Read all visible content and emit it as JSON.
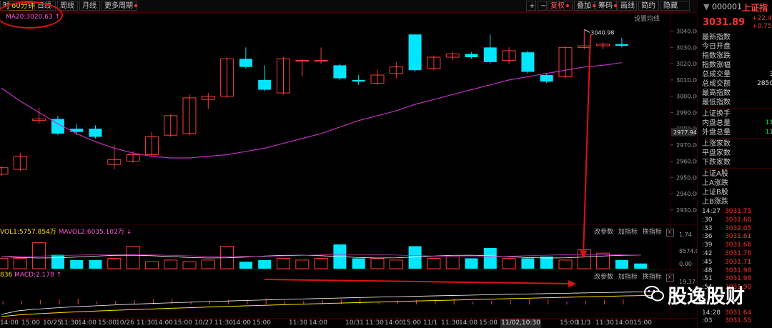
{
  "toolbar": {
    "left_tabs": [
      {
        "label": "时",
        "active": false
      },
      {
        "label": "60分钟",
        "active": true
      },
      {
        "label": "日线",
        "active": false
      },
      {
        "label": "周线",
        "active": false
      },
      {
        "label": "月线",
        "active": false
      },
      {
        "label": "更多周期",
        "active": false,
        "dot": true
      }
    ],
    "right_buttons": [
      {
        "label": "+"
      },
      {
        "label": "−"
      },
      {
        "label": "复权",
        "highlight": true,
        "dot": true
      },
      {
        "label": "叠加",
        "dot": true
      },
      {
        "label": "筹码",
        "dot": true
      },
      {
        "label": "画线"
      },
      {
        "label": "简约"
      },
      {
        "label": "隐藏"
      }
    ]
  },
  "indicator_labels": {
    "ma": "MA20:3020.63",
    "setting": "设置均线",
    "vol_prefix": "VOL1:5757.854万",
    "vol_ma": "MAVOL2:6035.102万",
    "macd_prefix": "836",
    "macd_label": "MACD:2.178"
  },
  "panel_controls": [
    "改参数",
    "加指标",
    "换指标"
  ],
  "panel_controls2": [
    "改参数",
    "加指标",
    "换指标"
  ],
  "price_tag": "2977.94",
  "chart_data": [
    {
      "type": "candlestick",
      "title": "",
      "ylim": [
        2922,
        3046
      ],
      "yticks": [
        3040,
        3030,
        3020,
        3010,
        3000,
        2990,
        2980,
        2970,
        2960,
        2950,
        2940,
        2930
      ],
      "ytick_labels": [
        "3040.00",
        "3030.00",
        "3020.00",
        "3010.00",
        "3000.00",
        "2990.00",
        "2980.00",
        "2970.00",
        "2960.00",
        "2950.00",
        "2940.00",
        "2930.00"
      ],
      "annotation": {
        "text": "3040.98",
        "value": 3040.98,
        "index": 31
      },
      "candles": [
        {
          "o": 2952,
          "c": 2956,
          "h": 2957,
          "l": 2951
        },
        {
          "o": 2955,
          "c": 2963,
          "h": 2965,
          "l": 2954
        },
        {
          "o": 2985,
          "c": 2986,
          "h": 2993,
          "l": 2983
        },
        {
          "o": 2986,
          "c": 2977,
          "h": 2988,
          "l": 2976
        },
        {
          "o": 2980,
          "c": 2978,
          "h": 2983,
          "l": 2976
        },
        {
          "o": 2980,
          "c": 2975,
          "h": 2982,
          "l": 2974
        },
        {
          "o": 2958,
          "c": 2961,
          "h": 2970,
          "l": 2955
        },
        {
          "o": 2960,
          "c": 2964,
          "h": 2966,
          "l": 2959
        },
        {
          "o": 2964,
          "c": 2975,
          "h": 2978,
          "l": 2963
        },
        {
          "o": 2976,
          "c": 2988,
          "h": 2989,
          "l": 2975
        },
        {
          "o": 2977,
          "c": 2999,
          "h": 3001,
          "l": 2976
        },
        {
          "o": 2998,
          "c": 3000,
          "h": 3002,
          "l": 2992
        },
        {
          "o": 3000,
          "c": 3023,
          "h": 3024,
          "l": 2999
        },
        {
          "o": 3023,
          "c": 3018,
          "h": 3030,
          "l": 3017
        },
        {
          "o": 3010,
          "c": 3004,
          "h": 3019,
          "l": 3003
        },
        {
          "o": 3002,
          "c": 3023,
          "h": 3024,
          "l": 3001
        },
        {
          "o": 3022,
          "c": 3022,
          "h": 3023,
          "l": 3012
        },
        {
          "o": 3022,
          "c": 3022,
          "h": 3030,
          "l": 3020
        },
        {
          "o": 3019,
          "c": 3011,
          "h": 3020,
          "l": 3010
        },
        {
          "o": 3010,
          "c": 3009,
          "h": 3013,
          "l": 3007
        },
        {
          "o": 3008,
          "c": 3013,
          "h": 3016,
          "l": 3007
        },
        {
          "o": 3014,
          "c": 3018,
          "h": 3021,
          "l": 3011
        },
        {
          "o": 3038,
          "c": 3016,
          "h": 3038,
          "l": 3015
        },
        {
          "o": 3017,
          "c": 3024,
          "h": 3025,
          "l": 3016
        },
        {
          "o": 3024,
          "c": 3026,
          "h": 3027,
          "l": 3022
        },
        {
          "o": 3026,
          "c": 3024,
          "h": 3027,
          "l": 3023
        },
        {
          "o": 3030,
          "c": 3021,
          "h": 3038,
          "l": 3020
        },
        {
          "o": 3022,
          "c": 3028,
          "h": 3030,
          "l": 3020
        },
        {
          "o": 3027,
          "c": 3015,
          "h": 3028,
          "l": 3014
        },
        {
          "o": 3013,
          "c": 3009,
          "h": 3014,
          "l": 3008
        },
        {
          "o": 3012,
          "c": 3030,
          "h": 3031,
          "l": 3011
        },
        {
          "o": 3030,
          "c": 3031,
          "h": 3041,
          "l": 3029
        },
        {
          "o": 3031,
          "c": 3032,
          "h": 3033,
          "l": 3029
        },
        {
          "o": 3032,
          "c": 3031,
          "h": 3036,
          "l": 3030
        }
      ],
      "ma20": [
        3005,
        2997,
        2990,
        2983,
        2977,
        2972,
        2968,
        2965,
        2963,
        2962,
        2962,
        2963,
        2964,
        2966,
        2968,
        2971,
        2974,
        2977,
        2981,
        2985,
        2988,
        2991,
        2995,
        2998,
        3001,
        3004,
        3007,
        3010,
        3012,
        3014,
        3016,
        3018,
        3019,
        3020.63
      ]
    },
    {
      "type": "bar",
      "title": "Volume",
      "ylim": [
        0,
        19
      ],
      "yticks": [
        1.74,
        8574.0,
        0.0
      ],
      "ytick_labels": [
        "1.74",
        "8574.00",
        "0.00"
      ],
      "values": [
        6,
        6,
        15,
        8,
        5,
        5,
        6,
        13,
        4,
        5,
        4,
        5,
        13,
        4,
        5,
        6,
        5,
        6,
        14,
        6,
        6,
        5,
        13,
        6,
        7,
        6,
        12,
        6,
        6,
        7,
        5,
        11,
        9,
        5,
        3
      ]
    }
  ],
  "x_axis": {
    "labels": [
      "14:00",
      "15:00",
      "10/25",
      "11:30",
      "14:00",
      "15:00",
      "10/26",
      "11:30",
      "14:00",
      "15:00",
      "10/27",
      "11:30",
      "14:00",
      "15:00",
      "11:30",
      "14:00",
      "10/31",
      "11:30",
      "14:00",
      "15:00",
      "11/1",
      "11:30",
      "14:00",
      "15:00",
      "11/02,10:30",
      "15:00",
      "11/3",
      "11:30",
      "14:00",
      "15:00"
    ],
    "highlight": "11/02,10:30"
  },
  "right_panel": {
    "code": "000001",
    "name": "上证指",
    "price": "3031.89",
    "change_line1": "+22.4",
    "change_line2": "+0.75",
    "rows": [
      {
        "label": "最新指数",
        "value": ""
      },
      {
        "label": "今日开盘",
        "value": ""
      },
      {
        "label": "指数涨跌",
        "value": ""
      },
      {
        "label": "指数涨幅",
        "value": ""
      },
      {
        "label": "总成交量",
        "value": "3"
      },
      {
        "label": "总成交额",
        "value": "2850"
      },
      {
        "label": "最高指数",
        "value": ""
      },
      {
        "label": "最低指数",
        "value": ""
      },
      {
        "sep": true
      },
      {
        "label": "上证换手",
        "value": ""
      },
      {
        "label": "内盘总量",
        "value": "11"
      },
      {
        "label": "外盘总量",
        "value": "11"
      },
      {
        "sep": true
      },
      {
        "label": "上涨家数",
        "value": ""
      },
      {
        "label": "平盘家数",
        "value": ""
      },
      {
        "label": "下跌家数",
        "value": ""
      },
      {
        "sep": true
      },
      {
        "label": "上证A股",
        "value": ""
      },
      {
        "label": "上A涨跌",
        "value": ""
      },
      {
        "label": "上证B股",
        "value": ""
      },
      {
        "label": "上B涨跌",
        "value": ""
      }
    ],
    "ticks": [
      {
        "t": "14:27",
        "p": "3031.75"
      },
      {
        "t": ":30",
        "p": "3031.60"
      },
      {
        "t": ":33",
        "p": "3032.05"
      },
      {
        "t": ":36",
        "p": "3031.61"
      },
      {
        "t": ":39",
        "p": "3031.66"
      },
      {
        "t": ":42",
        "p": "3031.76"
      },
      {
        "t": ":45",
        "p": "3031.71"
      },
      {
        "t": ":48",
        "p": "3031.98"
      },
      {
        "t": ":51",
        "p": "3031.98"
      },
      {
        "t": ":54",
        "p": "3031.90"
      },
      {
        "t": "",
        "p": ""
      },
      {
        "t": "",
        "p": ""
      },
      {
        "t": "14:28",
        "p": "3031.64"
      },
      {
        "t": ":03",
        "p": "3031.55"
      }
    ]
  },
  "watermark": "股逸股财",
  "colors": {
    "up": "#ff3b3b",
    "down": "#00e6ff",
    "ma20": "#c030c0",
    "annot": "#e01010"
  }
}
